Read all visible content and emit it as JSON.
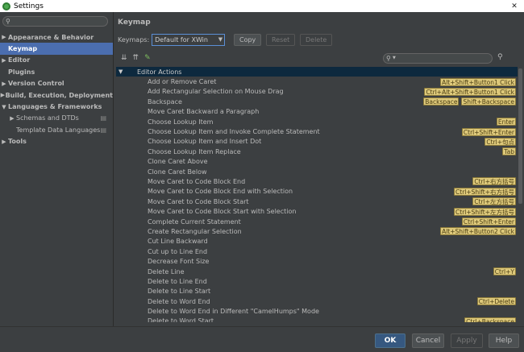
{
  "window": {
    "title": "Settings",
    "close_glyph": "✕"
  },
  "sidebar": {
    "search_placeholder": "",
    "items": [
      {
        "label": "Appearance & Behavior",
        "arrow": "▶",
        "bold": true
      },
      {
        "label": "Keymap",
        "arrow": "",
        "bold": true,
        "selected": true
      },
      {
        "label": "Editor",
        "arrow": "▶",
        "bold": true
      },
      {
        "label": "Plugins",
        "arrow": "",
        "bold": true
      },
      {
        "label": "Version Control",
        "arrow": "▶",
        "bold": true
      },
      {
        "label": "Build, Execution, Deployment",
        "arrow": "▶",
        "bold": true
      },
      {
        "label": "Languages & Frameworks",
        "arrow": "▼",
        "bold": true
      },
      {
        "label": "Schemas and DTDs",
        "arrow": "▶",
        "bold": false,
        "indent": 1,
        "gear": true
      },
      {
        "label": "Template Data Languages",
        "arrow": "",
        "bold": false,
        "indent": 1,
        "gear": true
      },
      {
        "label": "Tools",
        "arrow": "▶",
        "bold": true
      }
    ]
  },
  "main": {
    "title": "Keymap",
    "keymaps_label": "Keymaps:",
    "keymap_value": "Default for XWin",
    "copy_label": "Copy",
    "reset_label": "Reset",
    "delete_label": "Delete",
    "find_placeholder": "",
    "group": "Editor Actions",
    "actions": [
      {
        "name": "Add or Remove Caret",
        "keys": [
          "Alt+Shift+Button1 Click"
        ]
      },
      {
        "name": "Add Rectangular Selection on Mouse Drag",
        "keys": [
          "Ctrl+Alt+Shift+Button1 Click"
        ]
      },
      {
        "name": "Backspace",
        "keys": [
          "Backspace",
          "Shift+Backspace"
        ]
      },
      {
        "name": "Move Caret Backward a Paragraph",
        "keys": []
      },
      {
        "name": "Choose Lookup Item",
        "keys": [
          "Enter"
        ]
      },
      {
        "name": "Choose Lookup Item and Invoke Complete Statement",
        "keys": [
          "Ctrl+Shift+Enter"
        ]
      },
      {
        "name": "Choose Lookup Item and Insert Dot",
        "keys": [
          "Ctrl+句点"
        ]
      },
      {
        "name": "Choose Lookup Item Replace",
        "keys": [
          "Tab"
        ]
      },
      {
        "name": "Clone Caret Above",
        "keys": []
      },
      {
        "name": "Clone Caret Below",
        "keys": []
      },
      {
        "name": "Move Caret to Code Block End",
        "keys": [
          "Ctrl+右方括号"
        ]
      },
      {
        "name": "Move Caret to Code Block End with Selection",
        "keys": [
          "Ctrl+Shift+右方括号"
        ]
      },
      {
        "name": "Move Caret to Code Block Start",
        "keys": [
          "Ctrl+左方括号"
        ]
      },
      {
        "name": "Move Caret to Code Block Start with Selection",
        "keys": [
          "Ctrl+Shift+左方括号"
        ]
      },
      {
        "name": "Complete Current Statement",
        "keys": [
          "Ctrl+Shift+Enter"
        ]
      },
      {
        "name": "Create Rectangular Selection",
        "keys": [
          "Alt+Shift+Button2 Click"
        ]
      },
      {
        "name": "Cut Line Backward",
        "keys": []
      },
      {
        "name": "Cut up to Line End",
        "keys": []
      },
      {
        "name": "Decrease Font Size",
        "keys": []
      },
      {
        "name": "Delete Line",
        "keys": [
          "Ctrl+Y"
        ]
      },
      {
        "name": "Delete to Line End",
        "keys": []
      },
      {
        "name": "Delete to Line Start",
        "keys": []
      },
      {
        "name": "Delete to Word End",
        "keys": [
          "Ctrl+Delete"
        ]
      },
      {
        "name": "Delete to Word End in Different \"CamelHumps\" Mode",
        "keys": []
      },
      {
        "name": "Delete to Word Start",
        "keys": [
          "Ctrl+Backspace"
        ]
      }
    ]
  },
  "footer": {
    "ok_label": "OK",
    "cancel_label": "Cancel",
    "apply_label": "Apply",
    "help_label": "Help"
  },
  "colors": {
    "background": "#3c3f41",
    "selection": "#4b6eaf",
    "group_header": "#0d293e",
    "shortcut_badge": "#ddc87a",
    "ok_button": "#365880"
  }
}
